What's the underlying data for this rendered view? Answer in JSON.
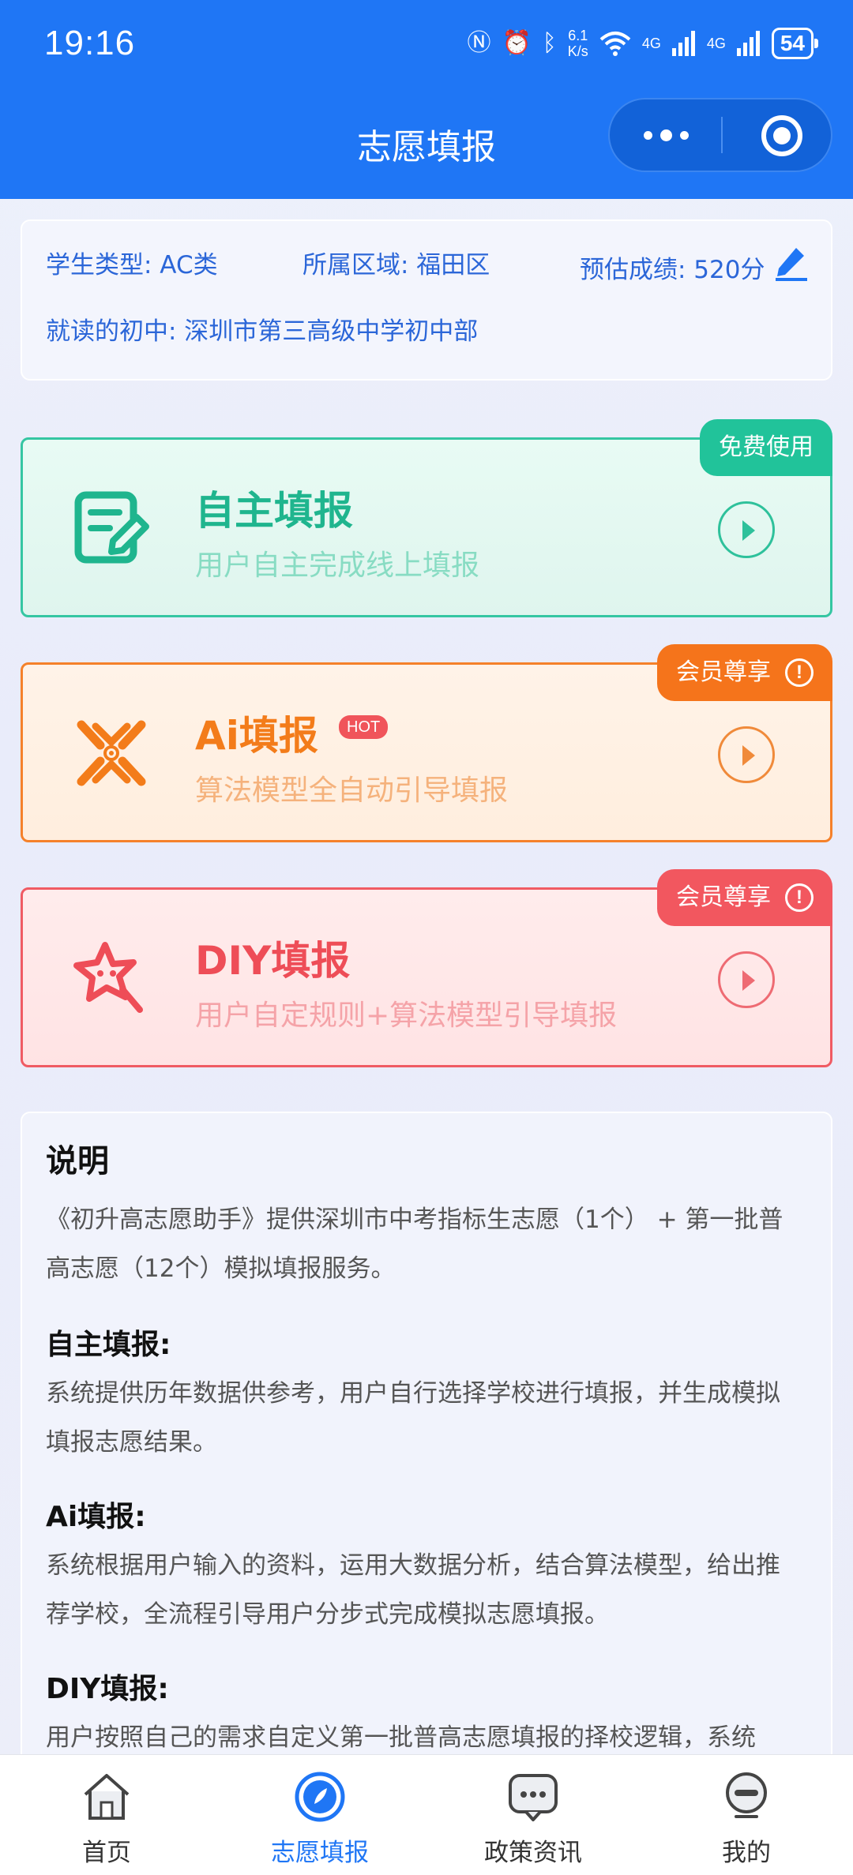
{
  "status_bar": {
    "time": "19:16",
    "speed_value": "6.1",
    "speed_unit": "K/s",
    "net1": "4G",
    "net2": "4G",
    "battery": "54"
  },
  "nav": {
    "title": "志愿填报"
  },
  "student_info": {
    "type": "学生类型: AC类",
    "region": "所属区域: 福田区",
    "score": "预估成绩: 520分",
    "school": "就读的初中:  深圳市第三高级中学初中部"
  },
  "options": [
    {
      "title": "自主填报",
      "subtitle": "用户自主完成线上填报",
      "tag": "免费使用",
      "icon": "edit-form-icon",
      "color": "#1fb58e"
    },
    {
      "title": "Ai填报",
      "badge": "HOT",
      "subtitle": "算法模型全自动引导填报",
      "tag": "会员尊享",
      "tag_icon": "!",
      "icon": "ai-cross-icon",
      "color": "#f37c1a"
    },
    {
      "title": "DIY填报",
      "subtitle": "用户自定规则+算法模型引导填报",
      "tag": "会员尊享",
      "tag_icon": "!",
      "icon": "star-wand-icon",
      "color": "#ee4d57"
    }
  ],
  "description": {
    "heading": "说明",
    "intro": "《初升高志愿助手》提供深圳市中考指标生志愿（1个） + 第一批普高志愿（12个）模拟填报服务。",
    "sections": [
      {
        "title": "自主填报:",
        "text": "系统提供历年数据供参考，用户自行选择学校进行填报，并生成模拟填报志愿结果。"
      },
      {
        "title": "Ai填报:",
        "text": "系统根据用户输入的资料，运用大数据分析，结合算法模型，给出推荐学校，全流程引导用户分步式完成模拟志愿填报。"
      },
      {
        "title": "DIY填报:",
        "text": "用户按照自己的需求自定义第一批普高志愿填报的择校逻辑，系统"
      }
    ]
  },
  "tabbar": [
    {
      "label": "首页",
      "icon": "home-icon",
      "active": false
    },
    {
      "label": "志愿填报",
      "icon": "compass-icon",
      "active": true
    },
    {
      "label": "政策资讯",
      "icon": "chat-bubble-icon",
      "active": false
    },
    {
      "label": "我的",
      "icon": "profile-icon",
      "active": false
    }
  ],
  "colors": {
    "primary": "#1f76f5",
    "green": "#1fb58e",
    "orange": "#f37c1a",
    "red": "#ee4d57"
  }
}
